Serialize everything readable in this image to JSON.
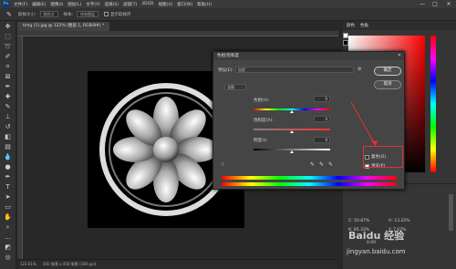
{
  "app": {
    "logo": "Ps",
    "menu": [
      "文件(F)",
      "编辑(E)",
      "图像(I)",
      "图层(L)",
      "文字(Y)",
      "选择(S)",
      "滤镜(T)",
      "3D(D)",
      "视图(V)",
      "窗口(W)",
      "帮助(H)"
    ],
    "window_controls": [
      "—",
      "□",
      "✕"
    ]
  },
  "options_bar": {
    "sample_size_label": "取样大小:",
    "sample_size_value": "取样点",
    "sample_label": "样本:",
    "sample_value": "所有图层",
    "ring_label": "显示取样环"
  },
  "document": {
    "tab_title": "timg (1).jpg @ 122% (图层 1, RGB/8#) *",
    "zoom": "122.61%",
    "doc_info": "450 像素 x 450 像素 (180 ppi)"
  },
  "right_panel": {
    "tabs": [
      "颜色",
      "色板"
    ],
    "props": [
      {
        "k": "C:",
        "v": "50.87%"
      },
      {
        "k": "H:",
        "v": "13.22%"
      },
      {
        "k": "K:",
        "v": "85.33%"
      },
      {
        "k": "Y:",
        "v": "7.67%"
      }
    ],
    "extra": "0.00"
  },
  "dialog": {
    "title": "色相/饱和度",
    "preset_label": "预设(E):",
    "preset_value": "自定",
    "channel_value": "全图",
    "hue_label": "色相(H):",
    "hue_value": "0",
    "saturation_label": "饱和度(A):",
    "saturation_value": "0",
    "lightness_label": "明度(I):",
    "lightness_value": "0",
    "ok_label": "确定",
    "cancel_label": "取消",
    "colorize_label": "着色(O)",
    "preview_label": "预览(P)",
    "colorize_checked": false,
    "preview_checked": true
  },
  "watermark": {
    "text": "Baidu 经验",
    "url": "jingyan.baidu.com"
  },
  "colors": {
    "annotation_red": "#e8302d",
    "accent_blue": "#31a8ff"
  }
}
